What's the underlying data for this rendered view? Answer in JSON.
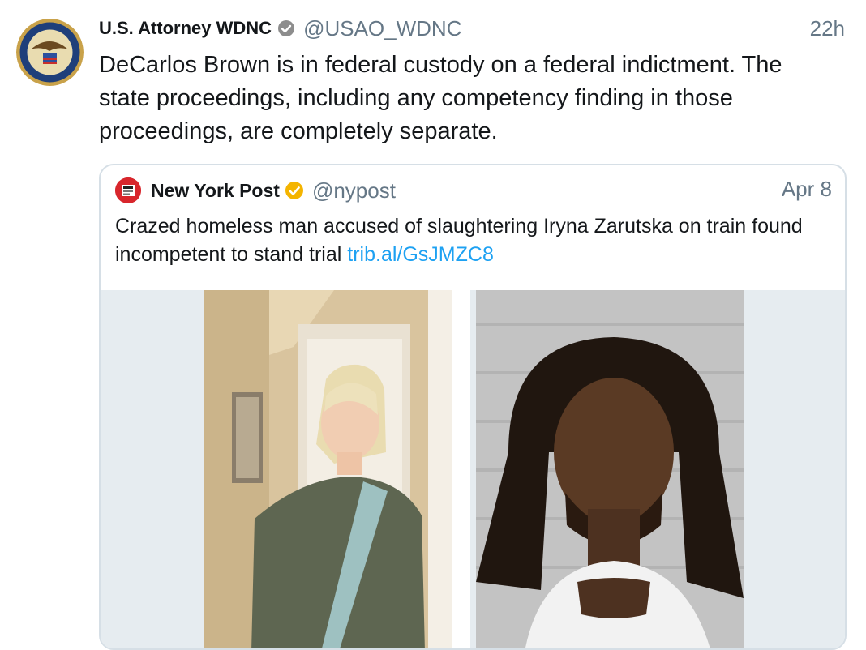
{
  "tweet": {
    "author_name": "U.S. Attorney WDNC",
    "handle": "@USAO_WDNC",
    "time": "22h",
    "text": "DeCarlos Brown is in federal custody on a federal indictment. The state proceedings, including any competency finding in those proceedings, are completely separate.",
    "avatar_icon": "doj-seal-icon",
    "badge_icon": "verified-gray-icon"
  },
  "quote": {
    "author_name": "New York Post",
    "handle": "@nypost",
    "time": "Apr 8",
    "text": "Crazed homeless man accused of slaughtering Iryna Zarutska on train found incompetent to stand trial ",
    "link": "trib.al/GsJMZC8",
    "avatar_icon": "nypost-logo-icon",
    "badge_icon": "verified-gold-icon"
  },
  "media": {
    "left_photo": "photo-woman",
    "right_photo": "photo-mugshot"
  },
  "colors": {
    "link": "#1da1f2",
    "secondary_text": "#657786",
    "gold_badge": "#f4b400",
    "gray_badge": "#8d8d8d"
  }
}
